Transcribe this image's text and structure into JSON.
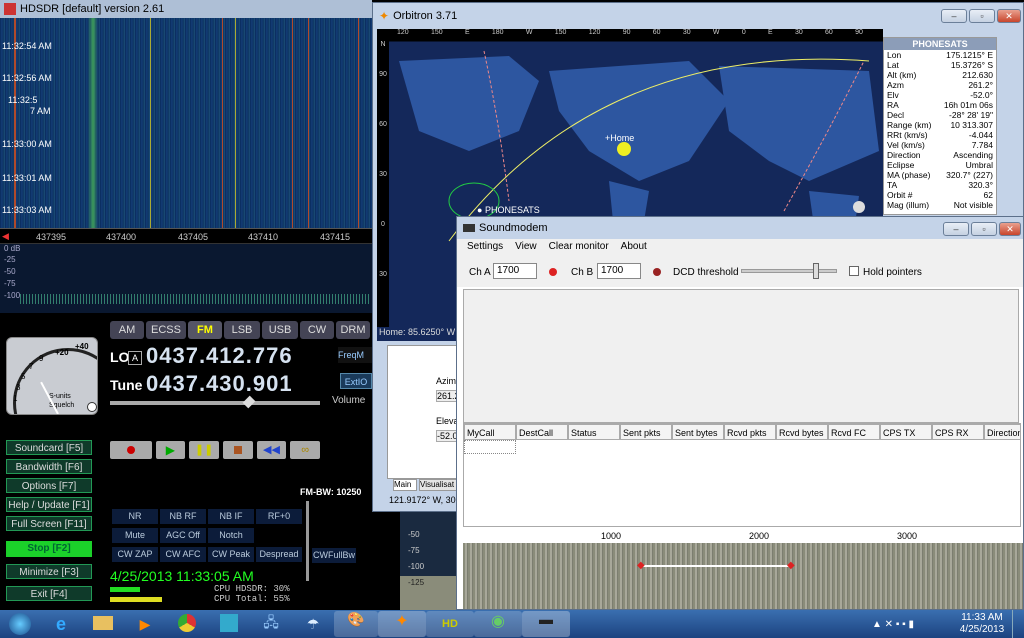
{
  "hdsdr": {
    "title": "HDSDR [default]  version 2.61",
    "times": [
      "11:32:54 AM",
      "11:32:56 AM",
      "11:32:5",
      "7 AM",
      "11:33:00 AM",
      "11:33:01 AM",
      "11:33:03 AM"
    ],
    "freq_ticks": [
      "437395",
      "437400",
      "437405",
      "437410",
      "437415"
    ],
    "db_labels": [
      "0 dB",
      "-25",
      "-50",
      "-75",
      "-100"
    ],
    "modes": [
      "AM",
      "ECSS",
      "FM",
      "LSB",
      "USB",
      "CW",
      "DRM"
    ],
    "lo_label": "LO",
    "lo_a": "A",
    "lo_value": "0437.412.776",
    "tune_label": "Tune",
    "tune_value": "0437.430.901",
    "freqm": "FreqM",
    "extio": "ExtIO",
    "volume": "Volume",
    "smeter": {
      "scale": [
        "+40",
        "+20",
        "9",
        "7",
        "5",
        "3",
        "1"
      ],
      "label1": "S-units",
      "label2": "Squelch"
    },
    "buttons": [
      "Soundcard [F5]",
      "Bandwidth [F6]",
      "Options [F7]",
      "Help / Update [F1]",
      "Full Screen [F11]",
      "Stop [F2]",
      "Minimize [F3]",
      "Exit [F4]"
    ],
    "fm_bw": "FM-BW: 10250",
    "dsp": [
      "NR",
      "NB RF",
      "NB IF",
      "RF+0",
      "Mute",
      "AGC Off",
      "Notch",
      "CW ZAP",
      "CW AFC",
      "CW Peak",
      "Despread",
      "CWFullBw"
    ],
    "datetime": "4/25/2013 11:33:05 AM",
    "cpu1": "CPU HDSDR:  30%",
    "cpu2": "CPU Total:  55%",
    "wf_scale": [
      "-50",
      "-75",
      "-100",
      "-125"
    ]
  },
  "orbitron": {
    "title": "Orbitron 3.71",
    "lon_ticks": [
      "120",
      "150",
      "E",
      "180",
      "W",
      "150",
      "120",
      "90",
      "60",
      "30",
      "W",
      "0",
      "E",
      "30",
      "60",
      "90"
    ],
    "lat_ticks": [
      "N",
      "90",
      "60",
      "30",
      "0",
      "30"
    ],
    "sat_label": "PHONESATS",
    "home_label": "Home",
    "status": "Home: 85.6250° W",
    "coord": "121.9172° W, 30",
    "azimuth": "Azimu",
    "az_val": "261.2",
    "elev": "Eleva",
    "el_val": "-52.0",
    "tabs": [
      "Main",
      "Visualisat"
    ],
    "panel": {
      "title": "PHONESATS",
      "rows": [
        [
          "Lon",
          "175.1215° E"
        ],
        [
          "Lat",
          "15.3726° S"
        ],
        [
          "Alt (km)",
          "212.630"
        ],
        [
          "Azm",
          "261.2°"
        ],
        [
          "Elv",
          "-52.0°"
        ],
        [
          "RA",
          "16h 01m 06s"
        ],
        [
          "Decl",
          "-28° 28' 19\""
        ],
        [
          "Range (km)",
          "10 313.307"
        ],
        [
          "RRt (km/s)",
          "-4.044"
        ],
        [
          "Vel (km/s)",
          "7.784"
        ],
        [
          "Direction",
          "Ascending"
        ],
        [
          "Eclipse",
          "Umbral"
        ],
        [
          "MA (phase)",
          "320.7° (227)"
        ],
        [
          "TA",
          "320.3°"
        ],
        [
          "Orbit #",
          "62"
        ],
        [
          "Mag (illum)",
          "Not visible"
        ]
      ]
    }
  },
  "soundmodem": {
    "title": "Soundmodem",
    "menu": [
      "Settings",
      "View",
      "Clear monitor",
      "About"
    ],
    "cha_label": "Ch A",
    "cha_value": "1700",
    "chb_label": "Ch B",
    "chb_value": "1700",
    "dcd": "DCD threshold",
    "hold": "Hold pointers",
    "columns": [
      "MyCall",
      "DestCall",
      "Status",
      "Sent pkts",
      "Sent bytes",
      "Rcvd pkts",
      "Rcvd bytes",
      "Rcvd FC",
      "CPS TX",
      "CPS RX",
      "Direction"
    ],
    "scale": [
      "1000",
      "2000",
      "3000"
    ]
  },
  "taskbar": {
    "time": "11:33 AM",
    "date": "4/25/2013"
  }
}
